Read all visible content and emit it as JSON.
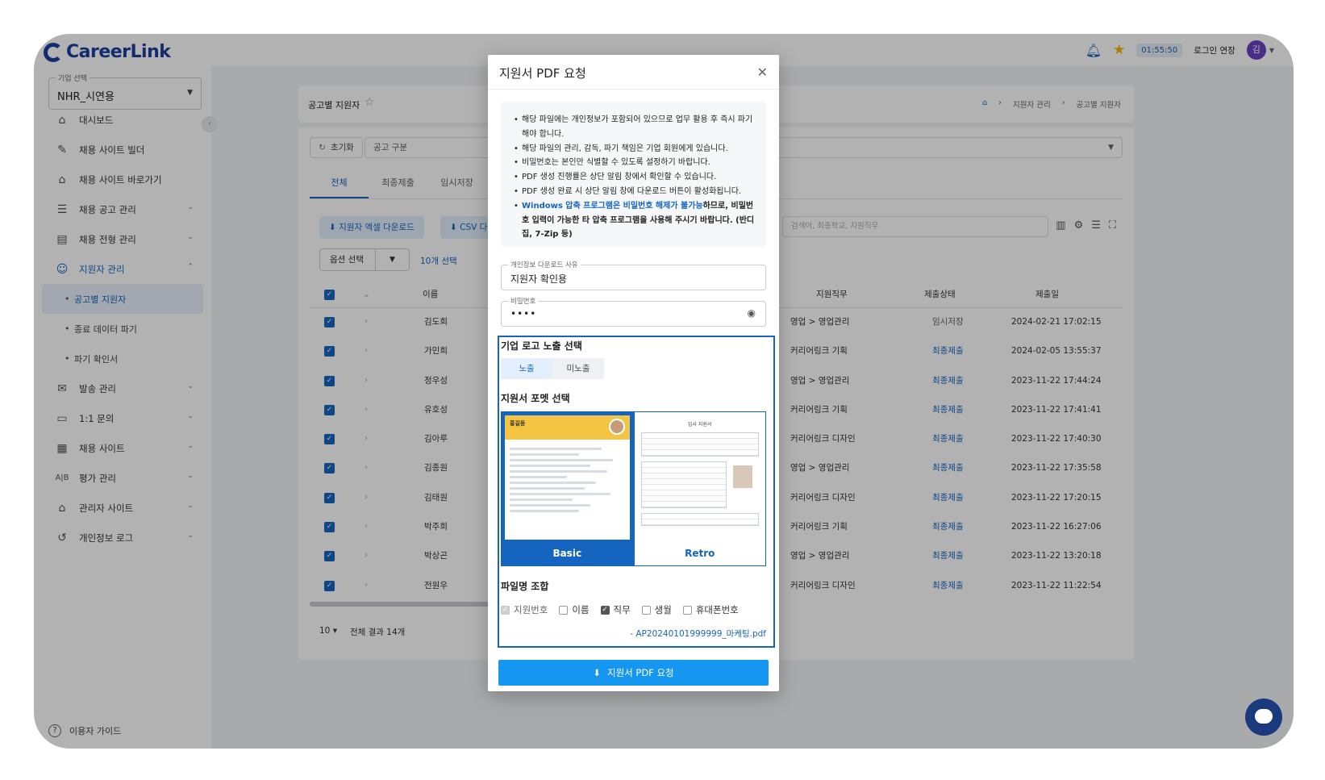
{
  "app": {
    "logo": "CareerLink"
  },
  "sidebar": {
    "corp_label": "기업 선택",
    "corp_value": "NHR_시연용",
    "items": [
      {
        "label": "대시보드",
        "icon": "chart-icon"
      },
      {
        "label": "채용 사이트 빌더",
        "icon": "tools-icon"
      },
      {
        "label": "채용 사이트 바로가기",
        "icon": "home-icon"
      },
      {
        "label": "채용 공고 관리",
        "icon": "list-icon"
      },
      {
        "label": "채용 전형 관리",
        "icon": "clipboard-icon"
      },
      {
        "label": "지원자 관리",
        "icon": "users-icon"
      },
      {
        "label": "공고별 지원자"
      },
      {
        "label": "종료 데이터 파기"
      },
      {
        "label": "파기 확인서"
      },
      {
        "label": "발송 관리",
        "icon": "mail-icon"
      },
      {
        "label": "1:1 문의",
        "icon": "chat-icon"
      },
      {
        "label": "채용 사이트",
        "icon": "calendar-icon"
      },
      {
        "label": "평가 관리",
        "icon": "ab-icon"
      },
      {
        "label": "관리자 사이트",
        "icon": "home-gear-icon"
      },
      {
        "label": "개인정보 로그",
        "icon": "history-icon"
      }
    ],
    "guide": "이용자 가이드"
  },
  "header": {
    "timer": "01:55:50",
    "extend_login": "로그인 연장",
    "avatar": "김"
  },
  "page": {
    "title": "공고별 지원자",
    "breadcrumb": [
      "지원자 관리",
      "공고별 지원자"
    ],
    "reset": "초기화",
    "filter": "공고 구분",
    "tabs": [
      "전체",
      "최종제출",
      "임시저장"
    ],
    "btn_excel": "지원자 엑셀 다운로드",
    "btn_csv": "CSV 다",
    "option_select": "옵션 선택",
    "selected_count": "10개 선택",
    "search_placeholder": "검색어, 최종학교, 지원직무",
    "columns": {
      "name": "이름",
      "job": "지원직무",
      "status": "제출상태",
      "date": "제출일"
    },
    "rows": [
      {
        "name": "김도희",
        "job": "영업 > 영업관리",
        "status": "임시저장",
        "date": "2024-02-21 17:02:15"
      },
      {
        "name": "가민희",
        "job": "커리어링크 기획",
        "status": "최종제출",
        "date": "2024-02-05 13:55:37"
      },
      {
        "name": "정우성",
        "job": "영업 > 영업관리",
        "status": "최종제출",
        "date": "2023-11-22 17:44:24"
      },
      {
        "name": "유호성",
        "job": "커리어링크 기획",
        "status": "최종제출",
        "date": "2023-11-22 17:41:41"
      },
      {
        "name": "김아루",
        "job": "커리어링크 디자인",
        "status": "최종제출",
        "date": "2023-11-22 17:40:30"
      },
      {
        "name": "김종원",
        "job": "영업 > 영업관리",
        "status": "최종제출",
        "date": "2023-11-22 17:35:58"
      },
      {
        "name": "김태원",
        "job": "커리어링크 디자인",
        "status": "최종제출",
        "date": "2023-11-22 17:20:15"
      },
      {
        "name": "박주희",
        "job": "커리어링크 기획",
        "status": "최종제출",
        "date": "2023-11-22 16:27:06"
      },
      {
        "name": "박상곤",
        "job": "영업 > 영업관리",
        "status": "최종제출",
        "date": "2023-11-22 13:20:18"
      },
      {
        "name": "전원우",
        "job": "커리어링크 디자인",
        "status": "최종제출",
        "date": "2023-11-22 11:22:54"
      }
    ],
    "page_size": "10",
    "total": "전체 결과 14개"
  },
  "modal": {
    "title": "지원서 PDF 요청",
    "notices": [
      "해당 파일에는 개인정보가 포함되어 있으므로 업무 활용 후 즉시 파기해야 합니다.",
      "해당 파일의 관리, 감독, 파기 책임은 기업 회원에게 있습니다.",
      "비밀번호는 본인만 식별할 수 있도록 설정하기 바랍니다.",
      "PDF 생성 진행률은 상단 알림 창에서 확인할 수 있습니다.",
      "PDF 생성 완료 시 상단 알림 창에 다운로드 버튼이 활성화됩니다."
    ],
    "notice_last_blue": "Windows 압축 프로그램은 비밀번호 해제가 불가능",
    "notice_last_rest": "하므로, 비밀번호 입력이 가능한 타 압축 프로그램을 사용해 주시기 바랍니다. (반디집, 7-Zip 등)",
    "reason_label": "개인정보 다운로드 사유",
    "reason_value": "지원자 확인용",
    "password_label": "비밀번호",
    "password_value": "••••",
    "logo_section": "기업 로고 노출 선택",
    "logo_options": [
      "노출",
      "미노출"
    ],
    "format_section": "지원서 포멧 선택",
    "formats": [
      "Basic",
      "Retro"
    ],
    "basic_thumb_name": "홍길동",
    "retro_thumb_title": "입사 지원서",
    "filename_section": "파일명 조합",
    "filename_options": [
      "지원번호",
      "이름",
      "직무",
      "생월",
      "휴대폰번호"
    ],
    "filename_preview": "- AP20240101999999_마케팅.pdf",
    "submit": "지원서 PDF 요청"
  }
}
